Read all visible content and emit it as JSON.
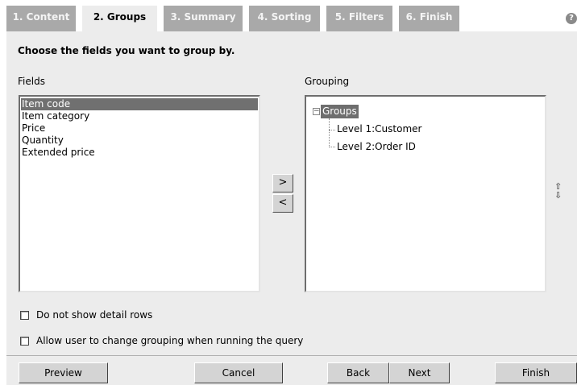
{
  "tabs": [
    {
      "label": "1. Content",
      "active": false
    },
    {
      "label": "2. Groups",
      "active": true
    },
    {
      "label": "3. Summary",
      "active": false
    },
    {
      "label": "4. Sorting",
      "active": false
    },
    {
      "label": "5. Filters",
      "active": false
    },
    {
      "label": "6. Finish",
      "active": false
    }
  ],
  "help_icon": "?",
  "panel": {
    "title": "Choose the fields you want to group by.",
    "fields_label": "Fields",
    "grouping_label": "Grouping"
  },
  "fields": [
    "Item code",
    "Item category",
    "Price",
    "Quantity",
    "Extended price"
  ],
  "selected_field": "Item code",
  "arrows": {
    "add": ">",
    "remove": "<"
  },
  "move_icons": {
    "up": "⇧",
    "down": "⇩"
  },
  "grouping": {
    "root": "Groups",
    "levels": [
      "Level 1:Customer",
      "Level 2:Order ID"
    ]
  },
  "options": [
    {
      "label": "Do not show detail rows",
      "checked": false
    },
    {
      "label": "Allow user to change grouping when running the query",
      "checked": false
    }
  ],
  "buttons": {
    "preview": "Preview",
    "cancel": "Cancel",
    "back": "Back",
    "next": "Next",
    "finish": "Finish"
  }
}
